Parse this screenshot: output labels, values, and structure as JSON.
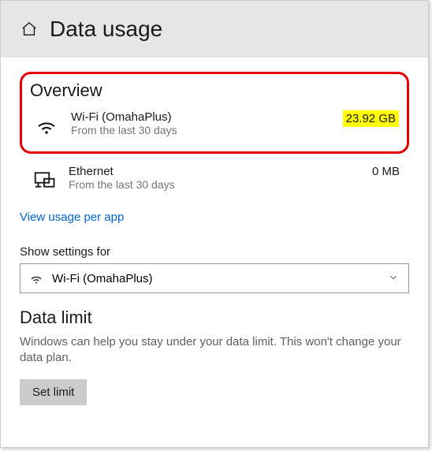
{
  "header": {
    "title": "Data usage"
  },
  "overview": {
    "title": "Overview",
    "items": [
      {
        "name": "Wi-Fi (OmahaPlus)",
        "sub": "From the last 30 days",
        "amount": "23.92 GB",
        "highlighted": true
      },
      {
        "name": "Ethernet",
        "sub": "From the last 30 days",
        "amount": "0 MB",
        "highlighted": false
      }
    ],
    "link": "View usage per app"
  },
  "filter": {
    "label": "Show settings for",
    "selected": "Wi-Fi (OmahaPlus)"
  },
  "limit": {
    "title": "Data limit",
    "desc": "Windows can help you stay under your data limit. This won't change your data plan.",
    "button": "Set limit"
  }
}
